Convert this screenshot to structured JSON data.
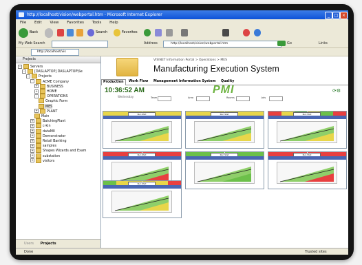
{
  "window": {
    "title": "http://localhost/vision/webportal.htm - Microsoft Internet Explorer",
    "menu": [
      "File",
      "Edit",
      "View",
      "Favorites",
      "Tools",
      "Help"
    ]
  },
  "toolbar": {
    "back_label": "Back",
    "search_label": "Search",
    "favorites_label": "Favorites",
    "go_label": "Go",
    "links_label": "Links"
  },
  "address": {
    "label": "Address",
    "url": "http://localhost/vision/webportal.htm",
    "web_search_label": "My Web Search",
    "left_url": "http://localhost/vis"
  },
  "sidebar": {
    "header": "Projects",
    "items": [
      {
        "label": "Servers",
        "indent": 0,
        "exp": "-"
      },
      {
        "label": "[DASLAPTOP] DASLAPTOP\\Se",
        "indent": 1,
        "exp": "-"
      },
      {
        "label": "Projects",
        "indent": 2,
        "exp": "-"
      },
      {
        "label": "ACME Company",
        "indent": 3,
        "exp": "-"
      },
      {
        "label": "BUSINESS",
        "indent": 4,
        "exp": "+"
      },
      {
        "label": "HOME",
        "indent": 4,
        "exp": "+"
      },
      {
        "label": "OPERATIONS",
        "indent": 4,
        "exp": "-"
      },
      {
        "label": "Graphic Form",
        "indent": 5,
        "exp": ""
      },
      {
        "label": "MES",
        "indent": 5,
        "exp": "",
        "selected": true
      },
      {
        "label": "PLANT",
        "indent": 4,
        "exp": "+"
      },
      {
        "label": "Main",
        "indent": 4,
        "exp": ""
      },
      {
        "label": "BatchingPlant",
        "indent": 3,
        "exp": "+"
      },
      {
        "label": "c-kin",
        "indent": 3,
        "exp": "+"
      },
      {
        "label": "dataMII",
        "indent": 3,
        "exp": "+"
      },
      {
        "label": "Demonstrator",
        "indent": 3,
        "exp": "+"
      },
      {
        "label": "Retail Banking",
        "indent": 3,
        "exp": "+"
      },
      {
        "label": "samples",
        "indent": 3,
        "exp": "+"
      },
      {
        "label": "Shapes Wizards and Exam",
        "indent": 3,
        "exp": "+"
      },
      {
        "label": "substation",
        "indent": 3,
        "exp": "+"
      },
      {
        "label": "visitors",
        "indent": 3,
        "exp": "+"
      }
    ],
    "bottom_tabs": [
      "Users",
      "Projects"
    ]
  },
  "content": {
    "breadcrumb": "VISINET Information Portal > Operations > MES",
    "title": "Manufacturing Execution System",
    "tabs": [
      "Production",
      "Work Flow",
      "Management Information System",
      "Quality"
    ],
    "active_tab": 0,
    "clock": "10:36:52 AM",
    "clock_sub": "Wednesday",
    "logo": "PMI",
    "filters": [
      "Team",
      "Area",
      "Rooms",
      "Lots"
    ],
    "panels": [
      {
        "label": "Run Stat",
        "colors": [
          "#e8d64a",
          "#e8d64a",
          "#e8d64a",
          "#e8d64a",
          "#e8d64a",
          "#e8d64a"
        ],
        "bar": "#e8d64a"
      },
      {
        "label": "Run Stat",
        "colors": [
          "#e8d64a",
          "#e8d64a",
          "#e8d64a",
          "#e8d64a",
          "#e8d64a",
          "#e8d64a"
        ],
        "bar": "#e8d64a"
      },
      {
        "label": "Run Stat",
        "colors": [
          "#e84040",
          "#e8d64a",
          "#6cc04a",
          "#e8d64a",
          "#6cc04a",
          "#e84040"
        ],
        "bar": "#e8d64a"
      },
      {
        "label": "Run Stat",
        "colors": [
          "#e84040",
          "#e84040",
          "#e84040",
          "#e84040",
          "#e84040",
          "#e84040"
        ],
        "bar": "#e84040"
      },
      {
        "label": "Run Stat",
        "colors": [
          "#6cc04a",
          "#6cc04a",
          "#6cc04a",
          "#6cc04a",
          "#6cc04a",
          "#6cc04a"
        ],
        "bar": "#6cc04a"
      },
      {
        "label": "Run Stat",
        "colors": [
          "#e84040",
          "#e84040",
          "#e84040",
          "#e84040",
          "#e84040",
          "#e84040"
        ],
        "bar": "#e84040"
      },
      {
        "label": "Run Stat",
        "colors": [
          "#6cc04a",
          "#e8d64a",
          "#e8d64a",
          "#e8d64a",
          "#e8d64a",
          "#e84040"
        ],
        "bar": "#e8d64a"
      }
    ]
  },
  "status": {
    "left": "Done",
    "right": "Trusted sites"
  }
}
